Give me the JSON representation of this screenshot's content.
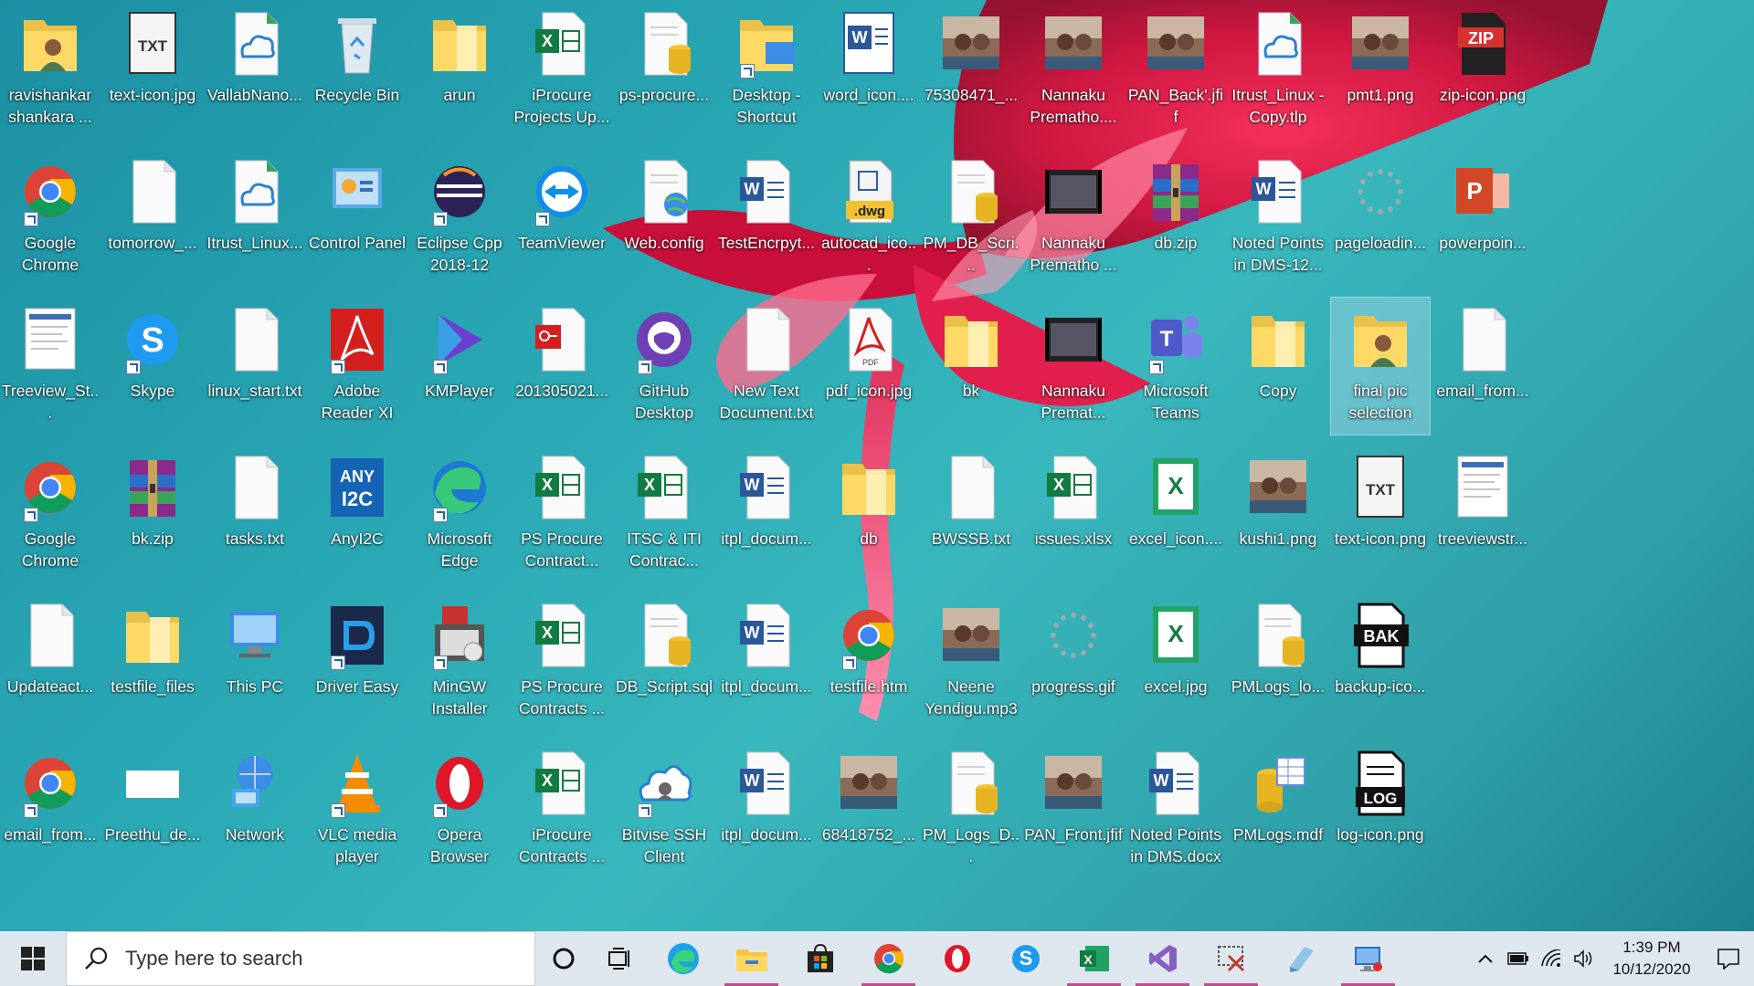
{
  "desktop": {
    "icons": [
      {
        "label": "ravishankar shankara ...",
        "kind": "user-folder"
      },
      {
        "label": "text-icon.jpg",
        "kind": "txt-image"
      },
      {
        "label": "VallabNano...",
        "kind": "cloud-file"
      },
      {
        "label": "Recycle Bin",
        "kind": "recycle-bin"
      },
      {
        "label": "arun",
        "kind": "folder"
      },
      {
        "label": "iProcure Projects Up...",
        "kind": "excel"
      },
      {
        "label": "ps-procure...",
        "kind": "db-file"
      },
      {
        "label": "Desktop - Shortcut",
        "kind": "folder-shortcut"
      },
      {
        "label": "word_icon....",
        "kind": "word-image"
      },
      {
        "label": "75308471_...",
        "kind": "photo"
      },
      {
        "label": "Nannaku Prematho....",
        "kind": "photo"
      },
      {
        "label": "PAN_Back'.jfif",
        "kind": "photo"
      },
      {
        "label": "Itrust_Linux - Copy.tlp",
        "kind": "cloud-file"
      },
      {
        "label": "pmt1.png",
        "kind": "photo"
      },
      {
        "label": "zip-icon.png",
        "kind": "zip-image"
      },
      {
        "label": "Google Chrome",
        "kind": "chrome"
      },
      {
        "label": "tomorrow_...",
        "kind": "blank-file"
      },
      {
        "label": "Itrust_Linux...",
        "kind": "cloud-file"
      },
      {
        "label": "Control Panel",
        "kind": "control-panel"
      },
      {
        "label": "Eclipse Cpp 2018-12",
        "kind": "eclipse"
      },
      {
        "label": "TeamViewer",
        "kind": "teamviewer"
      },
      {
        "label": "Web.config",
        "kind": "web-config"
      },
      {
        "label": "TestEncrpyt...",
        "kind": "word"
      },
      {
        "label": "autocad_ico...",
        "kind": "dwg"
      },
      {
        "label": "PM_DB_Scri...",
        "kind": "db-file"
      },
      {
        "label": "Nannaku Prematho ...",
        "kind": "video"
      },
      {
        "label": "db.zip",
        "kind": "winrar"
      },
      {
        "label": "Noted Points in DMS-12...",
        "kind": "word"
      },
      {
        "label": "pageloadin...",
        "kind": "loader"
      },
      {
        "label": "powerpoin...",
        "kind": "powerpoint"
      },
      {
        "label": "Treeview_St...",
        "kind": "screenshot"
      },
      {
        "label": "Skype",
        "kind": "skype"
      },
      {
        "label": "linux_start.txt",
        "kind": "blank-file"
      },
      {
        "label": "Adobe Reader XI",
        "kind": "adobe"
      },
      {
        "label": "KMPlayer",
        "kind": "kmplayer"
      },
      {
        "label": "201305021...",
        "kind": "pdf-key"
      },
      {
        "label": "GitHub Desktop",
        "kind": "github"
      },
      {
        "label": "New Text Document.txt",
        "kind": "blank-file"
      },
      {
        "label": "pdf_icon.jpg",
        "kind": "pdf"
      },
      {
        "label": "bk",
        "kind": "folder"
      },
      {
        "label": "Nannaku Premat...",
        "kind": "video"
      },
      {
        "label": "Microsoft Teams",
        "kind": "teams"
      },
      {
        "label": "Copy",
        "kind": "folder"
      },
      {
        "label": "final pic selection",
        "kind": "user-folder"
      },
      {
        "label": "email_from...",
        "kind": "blank-file"
      },
      {
        "label": "Google Chrome",
        "kind": "chrome"
      },
      {
        "label": "bk.zip",
        "kind": "winrar"
      },
      {
        "label": "tasks.txt",
        "kind": "blank-file"
      },
      {
        "label": "AnyI2C",
        "kind": "anyi2c"
      },
      {
        "label": "Microsoft Edge",
        "kind": "edge"
      },
      {
        "label": "PS Procure Contract...",
        "kind": "excel"
      },
      {
        "label": "ITSC & ITI Contrac...",
        "kind": "excel"
      },
      {
        "label": "itpl_docum...",
        "kind": "word"
      },
      {
        "label": "db",
        "kind": "folder"
      },
      {
        "label": "BWSSB.txt",
        "kind": "blank-file"
      },
      {
        "label": "issues.xlsx",
        "kind": "excel"
      },
      {
        "label": "excel_icon....",
        "kind": "excel-image"
      },
      {
        "label": "kushi1.png",
        "kind": "photo"
      },
      {
        "label": "text-icon.png",
        "kind": "txt-image"
      },
      {
        "label": "treeviewstr...",
        "kind": "screenshot"
      },
      {
        "label": "Updateact...",
        "kind": "blank-file"
      },
      {
        "label": "testfile_files",
        "kind": "folder"
      },
      {
        "label": "This PC",
        "kind": "this-pc"
      },
      {
        "label": "Driver Easy",
        "kind": "driver-easy"
      },
      {
        "label": "MinGW Installer",
        "kind": "mingw"
      },
      {
        "label": "PS Procure Contracts ...",
        "kind": "excel"
      },
      {
        "label": "DB_Script.sql",
        "kind": "db-file"
      },
      {
        "label": "itpl_docum...",
        "kind": "word"
      },
      {
        "label": "testfile.htm",
        "kind": "chrome"
      },
      {
        "label": "Neene Yendigu.mp3",
        "kind": "photo"
      },
      {
        "label": "progress.gif",
        "kind": "loader"
      },
      {
        "label": "excel.jpg",
        "kind": "excel-image"
      },
      {
        "label": "PMLogs_lo...",
        "kind": "db-file"
      },
      {
        "label": "backup-ico...",
        "kind": "bak"
      },
      {
        "label": "email_from...",
        "kind": "chrome"
      },
      {
        "label": "Preethu_de...",
        "kind": "white-rect"
      },
      {
        "label": "Network",
        "kind": "network"
      },
      {
        "label": "VLC media player",
        "kind": "vlc"
      },
      {
        "label": "Opera Browser",
        "kind": "opera"
      },
      {
        "label": "iProcure Contracts ...",
        "kind": "excel"
      },
      {
        "label": "Bitvise SSH Client",
        "kind": "bitvise"
      },
      {
        "label": "itpl_docum...",
        "kind": "word"
      },
      {
        "label": "68418752_...",
        "kind": "photo"
      },
      {
        "label": "PM_Logs_D...",
        "kind": "db-file"
      },
      {
        "label": "PAN_Front.jfif",
        "kind": "photo"
      },
      {
        "label": "Noted Points in DMS.docx",
        "kind": "word"
      },
      {
        "label": "PMLogs.mdf",
        "kind": "db-table"
      },
      {
        "label": "log-icon.png",
        "kind": "log"
      }
    ]
  },
  "taskbar": {
    "search_placeholder": "Type here to search",
    "pinned": [
      "cortana-icon",
      "task-view-icon",
      "edge-icon",
      "file-explorer-icon",
      "store-icon",
      "chrome-icon",
      "opera-icon",
      "skype-icon",
      "excel-icon",
      "visual-studio-icon",
      "snipping-tool-icon",
      "notepad-icon",
      "remote-desktop-icon"
    ],
    "time": "1:39 PM",
    "date": "10/12/2020"
  },
  "colors": {
    "accent": "#c44b8e",
    "taskbar": "#dfe7ee"
  }
}
